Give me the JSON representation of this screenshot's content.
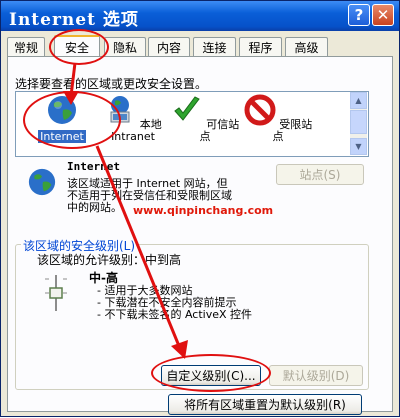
{
  "window": {
    "title": "Internet 选项",
    "help_glyph": "?",
    "close_glyph": "✕"
  },
  "tabs": [
    "常规",
    "安全",
    "隐私",
    "内容",
    "连接",
    "程序",
    "高级"
  ],
  "active_tab": "安全",
  "instruction": "选择要查看的区域或更改安全设置。",
  "zones": [
    {
      "label": "Internet",
      "icon": "globe-icon"
    },
    {
      "label": "本地\nIntranet",
      "icon": "intranet-computer-icon"
    },
    {
      "label": "可信站点",
      "icon": "checkmark-icon"
    },
    {
      "label": "受限站点",
      "icon": "no-entry-icon"
    }
  ],
  "selected_zone": "Internet",
  "zone_detail": {
    "name": "Internet",
    "description": "该区域适用于 Internet 网站，但\n不适用于列在受信任和受限制区域\n中的网站。",
    "sites_button": "站点(S)"
  },
  "watermark": "www.qinpinchang.com",
  "security_level": {
    "legend": "该区域的安全级别(L)",
    "allowed": "该区域的允许级别：中到高",
    "level_name": "中-高",
    "bullets": [
      "- 适用于大多数网站",
      "- 下载潜在不安全内容前提示",
      "- 不下载未签名的 ActiveX 控件"
    ],
    "custom_button": "自定义级别(C)...",
    "default_button": "默认级别(D)"
  },
  "reset_button": "将所有区域重置为默认级别(R)",
  "annotation_color": "#e01010",
  "colors": {
    "titlebar": "#0a5fd8",
    "selection": "#316ac5",
    "legend_text": "#0046d5"
  }
}
